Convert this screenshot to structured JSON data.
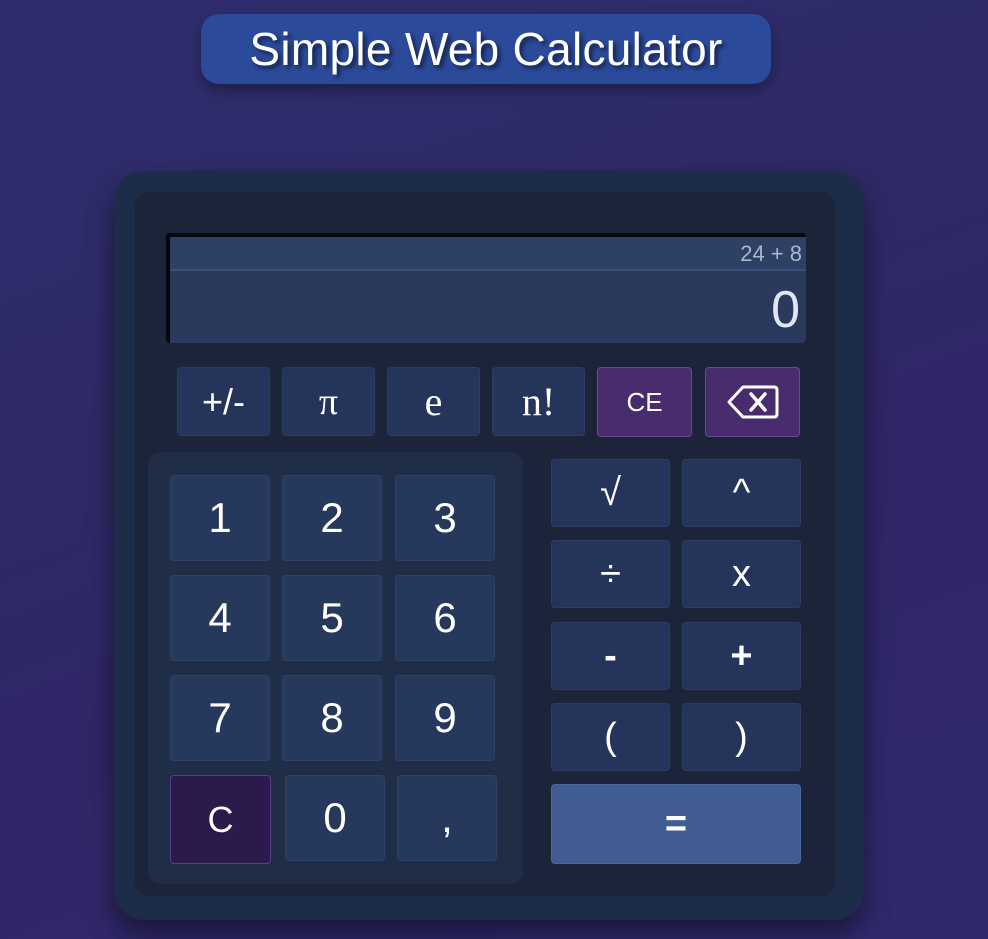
{
  "app": {
    "title": "Simple Web Calculator"
  },
  "display": {
    "history": "24 + 8",
    "current": "0"
  },
  "functions": {
    "negate": "+/-",
    "pi": "π",
    "e": "e",
    "factorial": "n!",
    "clear_entry": "CE",
    "backspace_icon": "backspace-icon"
  },
  "keypad": {
    "digits": [
      "1",
      "2",
      "3",
      "4",
      "5",
      "6",
      "7",
      "8",
      "9"
    ],
    "clear": "C",
    "zero": "0",
    "comma": ","
  },
  "operators": {
    "sqrt": "√",
    "power": "^",
    "divide": "÷",
    "multiply": "x",
    "minus": "-",
    "plus": "+",
    "open_paren": "(",
    "close_paren": ")",
    "equals": "="
  },
  "colors": {
    "background": "#2f2d6e",
    "title_pill": "#2b4a9a",
    "calculator_body": "#1d2c48",
    "button": "#24345a",
    "accent_purple": "#482c6e",
    "clear_button": "#2c1a4c",
    "equals_button": "#415c92"
  }
}
